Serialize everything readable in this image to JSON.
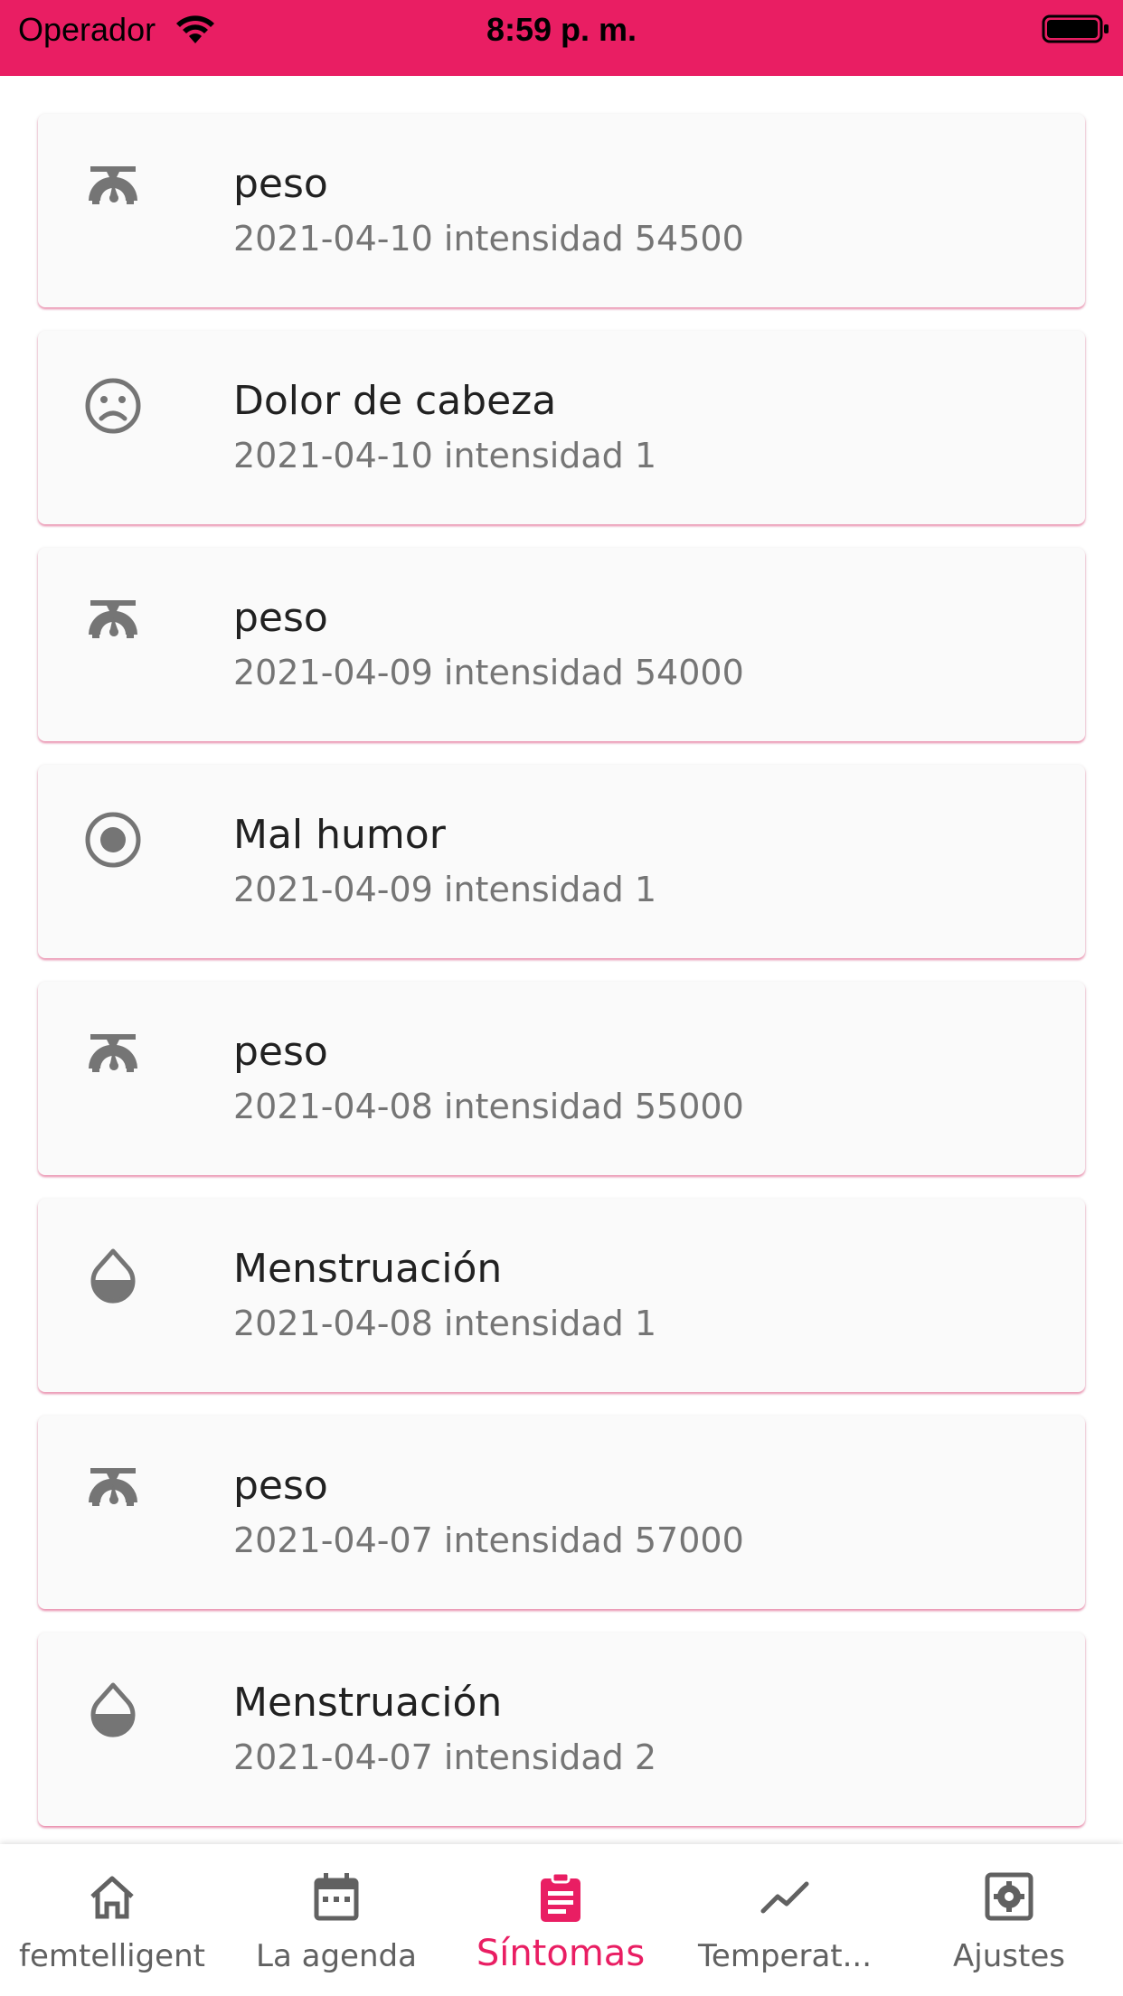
{
  "status_bar": {
    "carrier": "Operador",
    "time": "8:59 p. m."
  },
  "symptoms": [
    {
      "icon": "scale-icon",
      "title": "peso",
      "subtitle": "2021-04-10 intensidad 54500"
    },
    {
      "icon": "sad-face-icon",
      "title": "Dolor de cabeza",
      "subtitle": "2021-04-10 intensidad 1"
    },
    {
      "icon": "scale-icon",
      "title": "peso",
      "subtitle": "2021-04-09 intensidad 54000"
    },
    {
      "icon": "radio-button-icon",
      "title": "Mal humor",
      "subtitle": "2021-04-09 intensidad 1"
    },
    {
      "icon": "scale-icon",
      "title": "peso",
      "subtitle": "2021-04-08 intensidad 55000"
    },
    {
      "icon": "drop-icon",
      "title": "Menstruación",
      "subtitle": "2021-04-08 intensidad 1"
    },
    {
      "icon": "scale-icon",
      "title": "peso",
      "subtitle": "2021-04-07 intensidad 57000"
    },
    {
      "icon": "drop-icon",
      "title": "Menstruación",
      "subtitle": "2021-04-07 intensidad 2"
    }
  ],
  "bottom_nav": {
    "items": [
      {
        "icon": "home-icon",
        "label": "femtelligent",
        "active": false
      },
      {
        "icon": "calendar-icon",
        "label": "La agenda",
        "active": false
      },
      {
        "icon": "clipboard-icon",
        "label": "Síntomas",
        "active": true
      },
      {
        "icon": "trending-icon",
        "label": "Temperat...",
        "active": false
      },
      {
        "icon": "settings-icon",
        "label": "Ajustes",
        "active": false
      }
    ]
  },
  "colors": {
    "accent": "#e91e63",
    "icon_gray": "#757575",
    "text_primary": "#212121",
    "text_secondary": "#757575"
  }
}
